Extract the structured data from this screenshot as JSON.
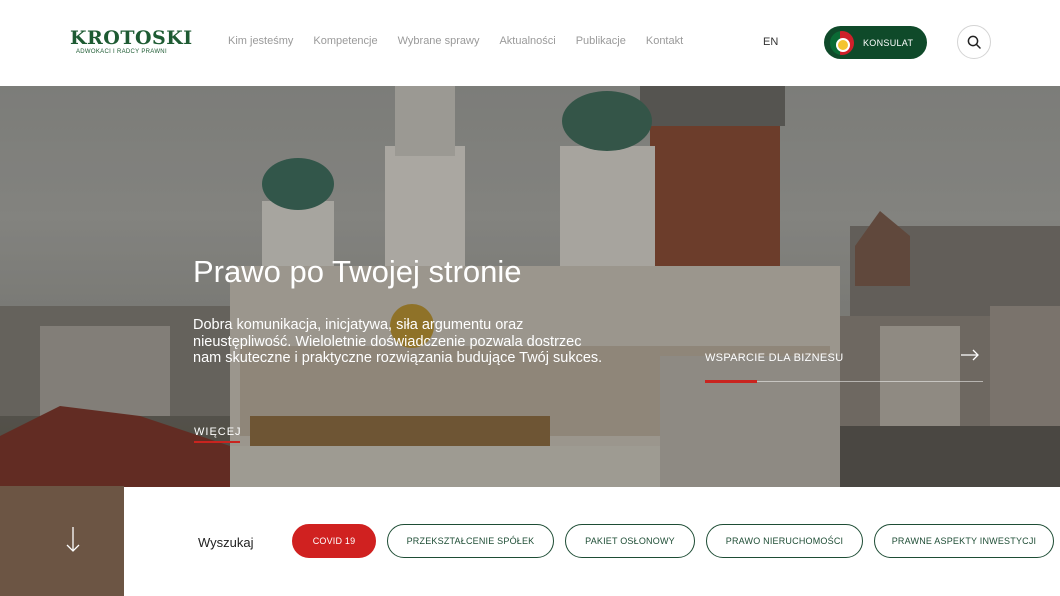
{
  "header": {
    "logo": {
      "name": "KROTOSKI",
      "tagline": "ADWOKACI I RADCY PRAWNI"
    },
    "nav": [
      {
        "label": "Kim jesteśmy"
      },
      {
        "label": "Kompetencje"
      },
      {
        "label": "Wybrane sprawy"
      },
      {
        "label": "Aktualności"
      },
      {
        "label": "Publikacje"
      },
      {
        "label": "Kontakt"
      }
    ],
    "language": "EN",
    "consulate_label": "KONSULAT",
    "search_icon": "search-icon"
  },
  "hero": {
    "title": "Prawo po Twojej stronie",
    "text": "Dobra komunikacja, inicjatywa, siła argumentu oraz nieustępliwość. Wieloletnie doświadczenie pozwala dostrzec nam skuteczne i praktyczne rozwiązania budujące Twój sukces.",
    "more_label": "WIĘCEJ",
    "business_label": "WSPARCIE DLA BIZNESU"
  },
  "search_panel": {
    "label": "Wyszukaj",
    "tags": [
      {
        "label": "COVID 19",
        "active": true
      },
      {
        "label": "PRZEKSZTAŁCENIE SPÓŁEK",
        "active": false
      },
      {
        "label": "PAKIET OSŁONOWY",
        "active": false
      },
      {
        "label": "PRAWO NIERUCHOMOŚCI",
        "active": false
      },
      {
        "label": "PRAWNE ASPEKTY INWESTYCJI",
        "active": false
      }
    ]
  },
  "colors": {
    "brand_green": "#1e5b33",
    "accent_red": "#d02120",
    "consulate_bg": "#0f4a2a"
  }
}
